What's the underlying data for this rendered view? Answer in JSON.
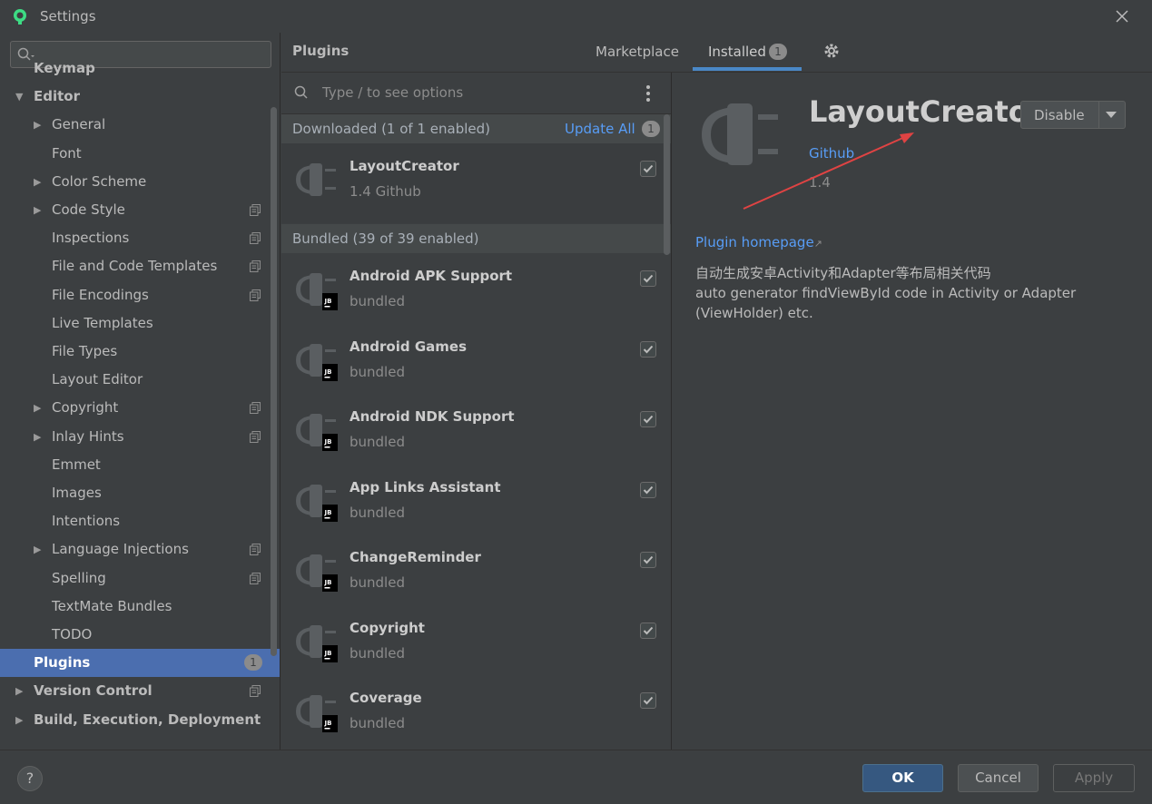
{
  "window": {
    "title": "Settings",
    "app_icon": "android-studio-icon",
    "close_icon": "close-icon"
  },
  "sidebar": {
    "search_placeholder": "",
    "items": [
      {
        "label": "Keymap",
        "bold": true
      },
      {
        "label": "Editor",
        "bold": true,
        "expanded": true
      },
      {
        "label": "General",
        "collapsible": true
      },
      {
        "label": "Font"
      },
      {
        "label": "Color Scheme",
        "collapsible": true
      },
      {
        "label": "Code Style",
        "collapsible": true,
        "project_icon": true
      },
      {
        "label": "Inspections",
        "project_icon": true
      },
      {
        "label": "File and Code Templates",
        "project_icon": true
      },
      {
        "label": "File Encodings",
        "project_icon": true
      },
      {
        "label": "Live Templates"
      },
      {
        "label": "File Types"
      },
      {
        "label": "Layout Editor"
      },
      {
        "label": "Copyright",
        "collapsible": true,
        "project_icon": true
      },
      {
        "label": "Inlay Hints",
        "collapsible": true,
        "project_icon": true
      },
      {
        "label": "Emmet"
      },
      {
        "label": "Images"
      },
      {
        "label": "Intentions"
      },
      {
        "label": "Language Injections",
        "collapsible": true,
        "project_icon": true
      },
      {
        "label": "Spelling",
        "project_icon": true
      },
      {
        "label": "TextMate Bundles"
      },
      {
        "label": "TODO"
      },
      {
        "label": "Plugins",
        "bold": true,
        "selected": true,
        "badge": "1"
      },
      {
        "label": "Version Control",
        "bold": true,
        "collapsible": true,
        "project_icon": true
      },
      {
        "label": "Build, Execution, Deployment",
        "bold": true,
        "collapsible": true
      }
    ]
  },
  "header": {
    "title": "Plugins",
    "tabs": [
      {
        "label": "Marketplace"
      },
      {
        "label": "Installed",
        "active": true,
        "badge": "1"
      }
    ],
    "gear_icon": "gear-icon"
  },
  "plugin_list": {
    "search_placeholder": "Type / to see options",
    "downloaded": {
      "label": "Downloaded (1 of 1 enabled)",
      "update_all": "Update All",
      "badge": "1",
      "plugins": [
        {
          "name": "LayoutCreator",
          "sub": "1.4  Github",
          "checked": true
        }
      ]
    },
    "bundled": {
      "label": "Bundled (39 of 39 enabled)",
      "plugins": [
        {
          "name": "Android APK Support",
          "sub": "bundled",
          "checked": true
        },
        {
          "name": "Android Games",
          "sub": "bundled",
          "checked": true
        },
        {
          "name": "Android NDK Support",
          "sub": "bundled",
          "checked": true
        },
        {
          "name": "App Links Assistant",
          "sub": "bundled",
          "checked": true
        },
        {
          "name": "ChangeReminder",
          "sub": "bundled",
          "checked": true
        },
        {
          "name": "Copyright",
          "sub": "bundled",
          "checked": true
        },
        {
          "name": "Coverage",
          "sub": "bundled",
          "checked": true
        }
      ]
    },
    "jb_badge": "JB"
  },
  "detail": {
    "name": "LayoutCreator",
    "vendor": "Github",
    "version": "1.4",
    "disable_label": "Disable",
    "homepage": "Plugin homepage",
    "homepage_arrow": "↗",
    "description": [
      "自动生成安卓Activity和Adapter等布局相关代码",
      "auto generator findViewById code in Activity or Adapter",
      "(ViewHolder) etc."
    ]
  },
  "footer": {
    "help": "?",
    "ok": "OK",
    "cancel": "Cancel",
    "apply": "Apply"
  },
  "colors": {
    "background": "#3c3f41",
    "selection": "#4b6eaf",
    "link": "#589df6",
    "annotation_arrow": "#e04343"
  }
}
